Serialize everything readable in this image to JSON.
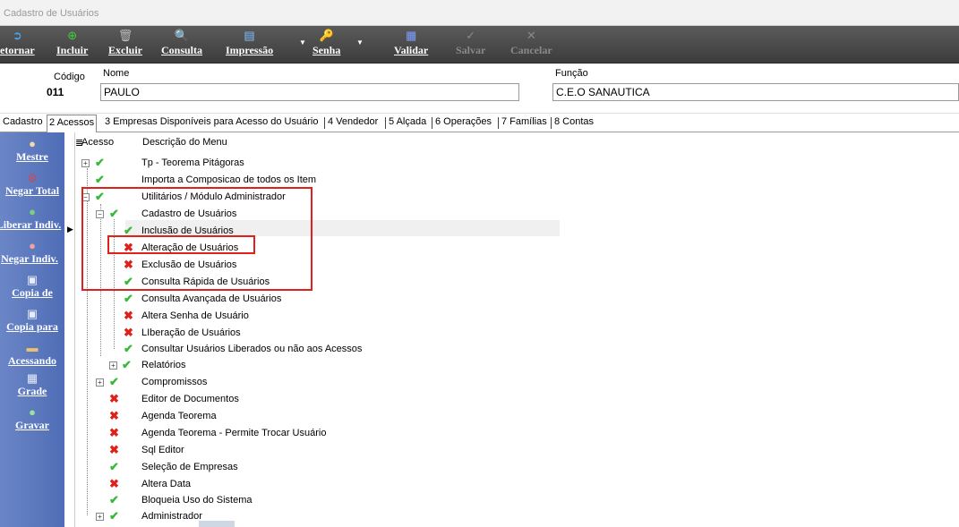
{
  "window": {
    "title": "Cadastro de Usuários"
  },
  "toolbar": {
    "retornar": "etornar",
    "incluir": "Incluir",
    "excluir": "Excluir",
    "consulta": "Consulta",
    "impressao": "Impressão",
    "senha": "Senha",
    "validar": "Validar",
    "salvar": "Salvar",
    "cancelar": "Cancelar"
  },
  "header": {
    "codigo_label": "Código",
    "codigo_value": "011",
    "nome_label": "Nome",
    "nome_value": "PAULO",
    "funcao_label": "Função",
    "funcao_value": "C.E.O SANAUTICA"
  },
  "tabs": [
    "Cadastro",
    "2 Acessos",
    "3 Empresas Disponíveis para Acesso do Usuário",
    "4 Vendedor",
    "5 Alçada",
    "6 Operações",
    "7 Famílias",
    "8 Contas"
  ],
  "sidebar": [
    "Mestre",
    "Negar Total",
    "Liberar Indiv.",
    "Negar Indiv.",
    "Copia de",
    "Copia para",
    "Acessando",
    "Grade",
    "Gravar"
  ],
  "tree": {
    "col_acesso": "Acesso",
    "col_descricao": "Descrição do Menu",
    "rows": [
      {
        "label": "Tp - Teorema Pitágoras",
        "access": "ok"
      },
      {
        "label": "Importa a Composicao de todos os Item",
        "access": "ok"
      },
      {
        "label": "Utilitários / Módulo Administrador",
        "access": "ok"
      },
      {
        "label": "Cadastro de Usuários",
        "access": "ok"
      },
      {
        "label": "Inclusão de Usuários",
        "access": "ok"
      },
      {
        "label": "Alteração de Usuários",
        "access": "no"
      },
      {
        "label": "Exclusão de Usuários",
        "access": "no"
      },
      {
        "label": "Consulta Rápida de Usuários",
        "access": "ok"
      },
      {
        "label": "Consulta Avançada de Usuários",
        "access": "ok"
      },
      {
        "label": "Altera Senha de Usuário",
        "access": "no"
      },
      {
        "label": "LIberação de Usuários",
        "access": "no"
      },
      {
        "label": "Consultar Usuários Liberados ou não aos Acessos",
        "access": "ok"
      },
      {
        "label": "Relatórios",
        "access": "ok"
      },
      {
        "label": "Compromissos",
        "access": "ok"
      },
      {
        "label": "Editor de Documentos",
        "access": "no"
      },
      {
        "label": "Agenda Teorema",
        "access": "no"
      },
      {
        "label": "Agenda Teorema - Permite Trocar Usuário",
        "access": "no"
      },
      {
        "label": "Sql Editor",
        "access": "no"
      },
      {
        "label": "Seleção de Empresas",
        "access": "ok"
      },
      {
        "label": "Altera Data",
        "access": "no"
      },
      {
        "label": "Bloqueia Uso do Sistema",
        "access": "ok"
      },
      {
        "label": "Administrador",
        "access": "ok"
      }
    ]
  },
  "colors": {
    "ok": "#38b838",
    "no": "#e0201a",
    "highlight": "#e0201a"
  }
}
